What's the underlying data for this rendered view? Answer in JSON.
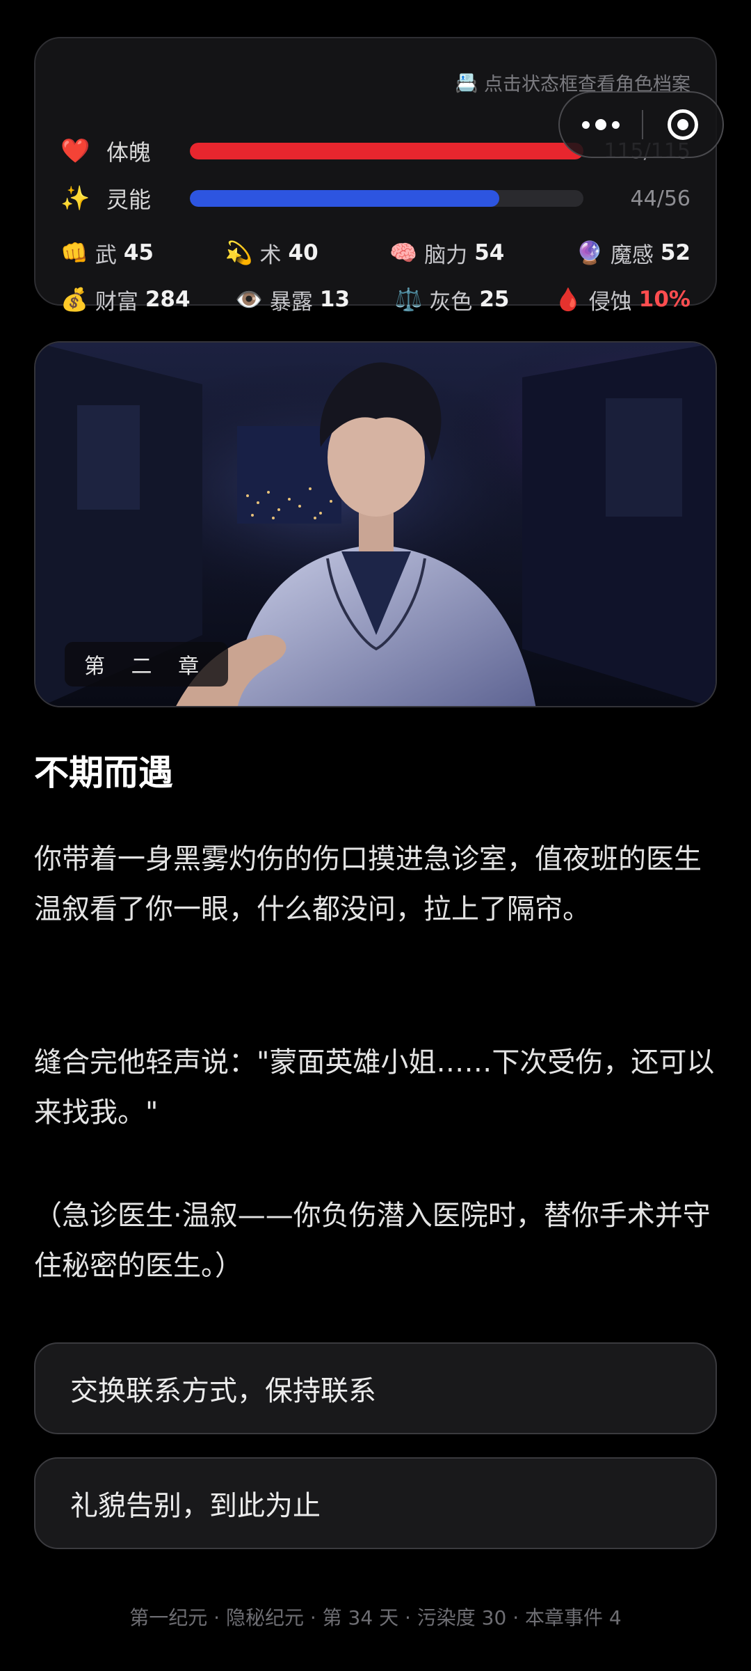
{
  "status": {
    "hint": "点击状态框查看角色档案",
    "hint_icon": "id-card-icon",
    "hp": {
      "icon": "❤️",
      "label": "体魄",
      "current": 115,
      "max": 115,
      "display": "115/115",
      "color": "#e8262e"
    },
    "mp": {
      "icon": "✨",
      "label": "灵能",
      "current": 44,
      "max": 56,
      "display": "44/56",
      "color": "#2d55e0"
    },
    "stats_row1": [
      {
        "icon": "👊",
        "label": "武",
        "value": "45"
      },
      {
        "icon": "💫",
        "label": "术",
        "value": "40"
      },
      {
        "icon": "🧠",
        "label": "脑力",
        "value": "54"
      },
      {
        "icon": "🔮",
        "label": "魔感",
        "value": "52"
      }
    ],
    "stats_row2": [
      {
        "icon": "💰",
        "label": "财富",
        "value": "284"
      },
      {
        "icon": "👁️",
        "label": "暴露",
        "value": "13"
      },
      {
        "icon": "⚖️",
        "label": "灰色",
        "value": "25"
      },
      {
        "icon": "🩸",
        "label": "侵蚀",
        "value": "10%",
        "danger_color": "#ff4d4f"
      }
    ]
  },
  "capsule": {
    "more_icon": "more-dots-icon",
    "close_icon": "close-circle-icon"
  },
  "chapter": {
    "badge": "第 二 章",
    "title": "不期而遇",
    "paragraphs": [
      "你带着一身黑雾灼伤的伤口摸进急诊室，值夜班的医生温叙看了你一眼，什么都没问，拉上了隔帘。",
      "缝合完他轻声说：\"蒙面英雄小姐……下次受伤，还可以来找我。\"",
      "（急诊医生·温叙——你负伤潜入医院时，替你手术并守住秘密的医生。）"
    ]
  },
  "choices": [
    {
      "label": "交换联系方式，保持联系"
    },
    {
      "label": "礼貌告别，到此为止"
    }
  ],
  "footer": "第一纪元 · 隐秘纪元 · 第 34 天 · 污染度 30 · 本章事件 4"
}
